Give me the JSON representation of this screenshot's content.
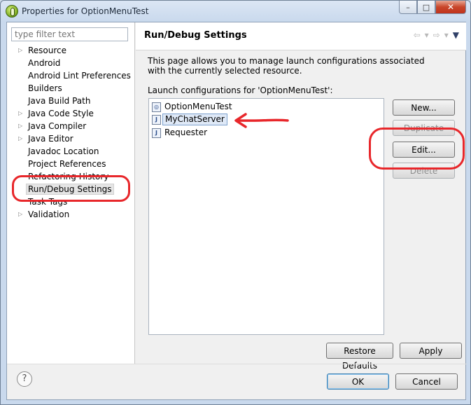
{
  "window": {
    "title": "Properties for OptionMenuTest",
    "controls": {
      "minimize": "–",
      "maximize": "□",
      "close": "✕"
    }
  },
  "sidebar": {
    "filter_placeholder": "type filter text",
    "items": [
      {
        "label": "Resource",
        "expandable": true
      },
      {
        "label": "Android",
        "expandable": false
      },
      {
        "label": "Android Lint Preferences",
        "expandable": false
      },
      {
        "label": "Builders",
        "expandable": false
      },
      {
        "label": "Java Build Path",
        "expandable": false
      },
      {
        "label": "Java Code Style",
        "expandable": true
      },
      {
        "label": "Java Compiler",
        "expandable": true
      },
      {
        "label": "Java Editor",
        "expandable": true
      },
      {
        "label": "Javadoc Location",
        "expandable": false
      },
      {
        "label": "Project References",
        "expandable": false
      },
      {
        "label": "Refactoring History",
        "expandable": false
      },
      {
        "label": "Run/Debug Settings",
        "expandable": false,
        "selected": true
      },
      {
        "label": "Task Tags",
        "expandable": false
      },
      {
        "label": "Validation",
        "expandable": true
      }
    ]
  },
  "page": {
    "title": "Run/Debug Settings",
    "description": "This page allows you to manage launch configurations associated with the currently selected resource.",
    "list_label": "Launch configurations for 'OptionMenuTest':",
    "configurations": [
      {
        "label": "OptionMenuTest",
        "icon": "android-app-icon"
      },
      {
        "label": "MyChatServer",
        "icon": "java-app-icon",
        "selected": true
      },
      {
        "label": "Requester",
        "icon": "java-app-icon"
      }
    ],
    "buttons": {
      "new": "New...",
      "duplicate": "Duplicate",
      "edit": "Edit...",
      "delete": "Delete"
    },
    "restore_defaults": "Restore Defaults",
    "apply": "Apply"
  },
  "nav": {
    "back": "⇦",
    "back_menu": "▾",
    "forward": "⇨",
    "forward_menu": "▾",
    "view_menu": "▼"
  },
  "footer": {
    "help": "?",
    "ok": "OK",
    "cancel": "Cancel"
  },
  "colors": {
    "annotation": "#e8272b",
    "selection": "#dfe9f7"
  }
}
